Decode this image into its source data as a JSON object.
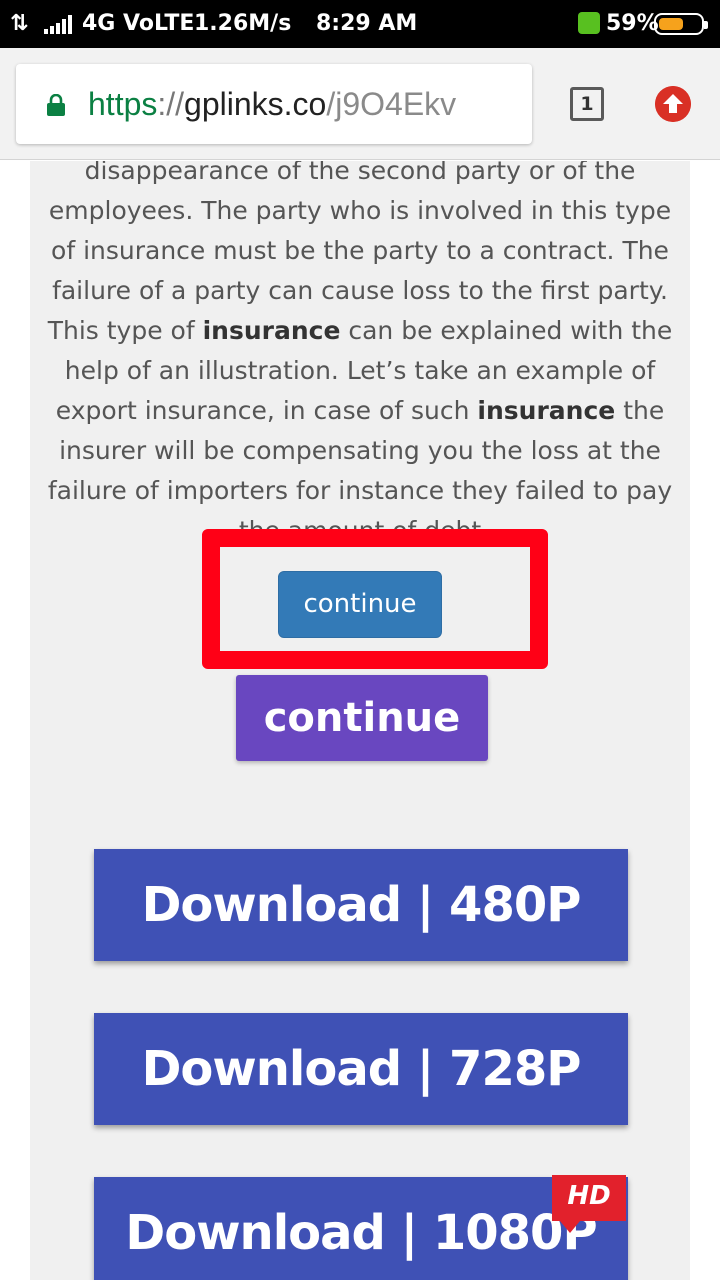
{
  "status_bar": {
    "network": "4G VoLTE",
    "speed": "1.26M/s",
    "time": "8:29 AM",
    "battery": "59%",
    "battery_level": 0.59
  },
  "browser": {
    "url_scheme": "https",
    "url_separator": "://",
    "url_host": "gplinks.co",
    "url_path": "/j9O4Ekv",
    "tab_count": "1"
  },
  "article": {
    "lines": [
      {
        "text": "disappearance of the second party or of the"
      },
      {
        "text": "employees. The party who is involved in this type"
      },
      {
        "text": "of insurance must be the party to a contract. The"
      },
      {
        "text": "failure of a party can cause loss to the first party."
      },
      {
        "pre": "This type of ",
        "bold": "insurance",
        "post": " can be explained with the"
      },
      {
        "text": "help of an illustration. Let’s take an example of"
      },
      {
        "pre": "export insurance, in case of such ",
        "bold": "insurance",
        "post": " the"
      },
      {
        "text": "insurer will be compensating you the loss at the"
      },
      {
        "text": "failure of importers for instance they failed to pay"
      },
      {
        "text": "the amount of debt"
      }
    ]
  },
  "buttons": {
    "continue_label": "continue",
    "continue_label_2": "continue",
    "download_480": "Download | 480P",
    "download_728": "Download | 728P",
    "download_1080": "Download | 1080P",
    "hd_badge": "HD"
  },
  "colors": {
    "highlight": "#ff0016",
    "continue_blue": "#337ab7",
    "continue_purple": "#6947c0",
    "download_blue": "#3f51b5"
  }
}
